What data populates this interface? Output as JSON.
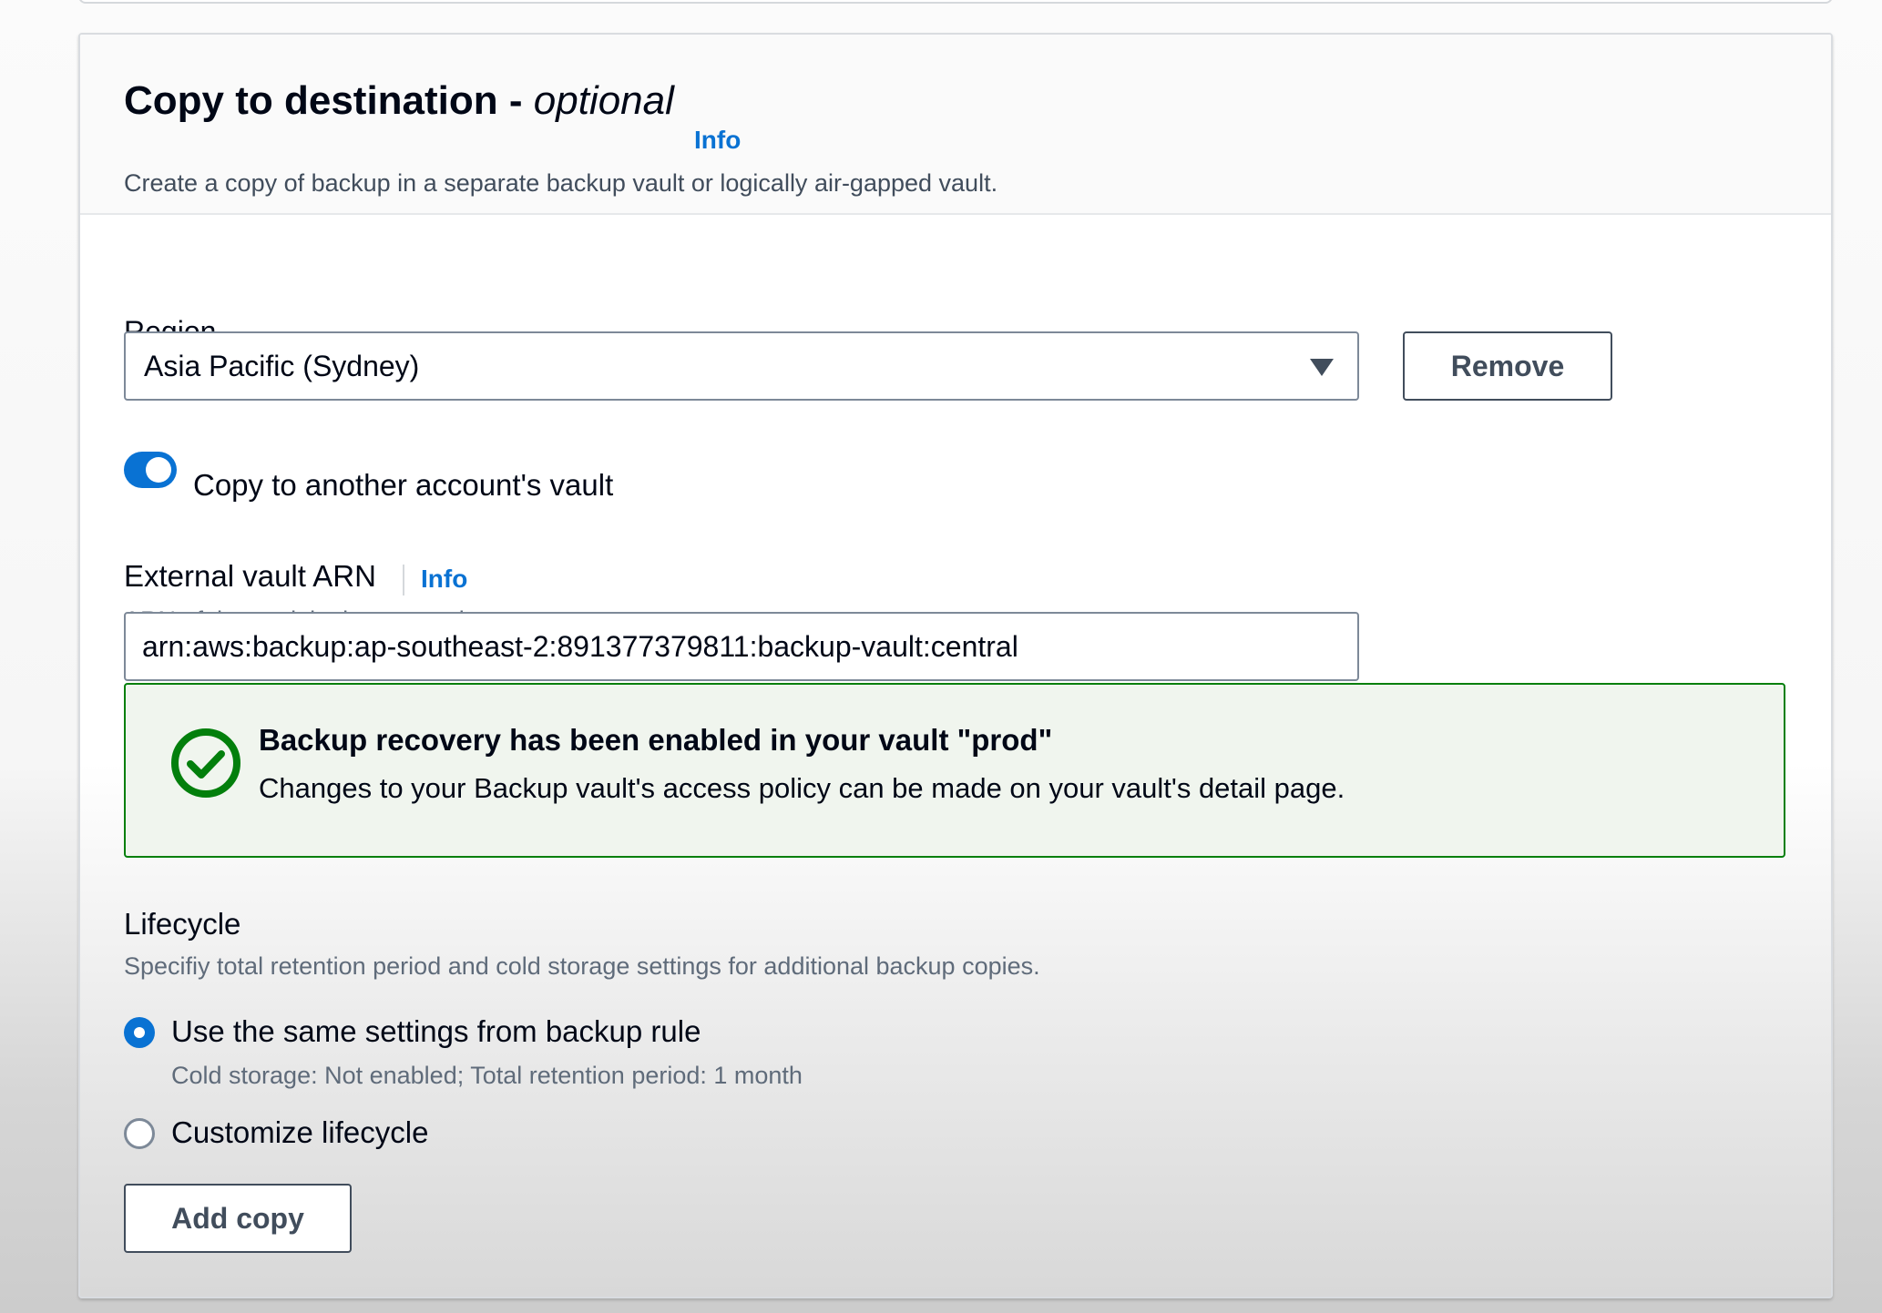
{
  "section": {
    "title": "Copy to destination",
    "title_separator": " - ",
    "title_optional": "optional",
    "info_label": "Info",
    "description": "Create a copy of backup in a separate backup vault or logically air-gapped vault."
  },
  "region": {
    "label": "Region",
    "selected_value": "Asia Pacific (Sydney)",
    "remove_label": "Remove"
  },
  "cross_account": {
    "toggle_label": "Copy to another account's vault",
    "enabled": true
  },
  "external_vault": {
    "label": "External vault ARN",
    "info_label": "Info",
    "description": "ARN of the vault in the external account.",
    "value": "arn:aws:backup:ap-southeast-2:891377379811:backup-vault:central"
  },
  "alert": {
    "type": "success",
    "icon": "check-circle-icon",
    "title": "Backup recovery has been enabled in your vault \"prod\"",
    "body": "Changes to your Backup vault's access policy can be made on your vault's detail page."
  },
  "lifecycle": {
    "label": "Lifecycle",
    "description": "Specifiy total retention period and cold storage settings for additional backup copies.",
    "options": [
      {
        "label": "Use the same settings from backup rule",
        "description": "Cold storage: Not enabled; Total retention period: 1 month",
        "selected": true
      },
      {
        "label": "Customize lifecycle",
        "selected": false
      }
    ]
  },
  "actions": {
    "add_copy_label": "Add copy"
  },
  "colors": {
    "accent": "#0972d3",
    "success_border": "#037f0c",
    "success_background": "#f0f5ee",
    "text_primary": "#000716",
    "text_secondary": "#5f6b7a"
  }
}
